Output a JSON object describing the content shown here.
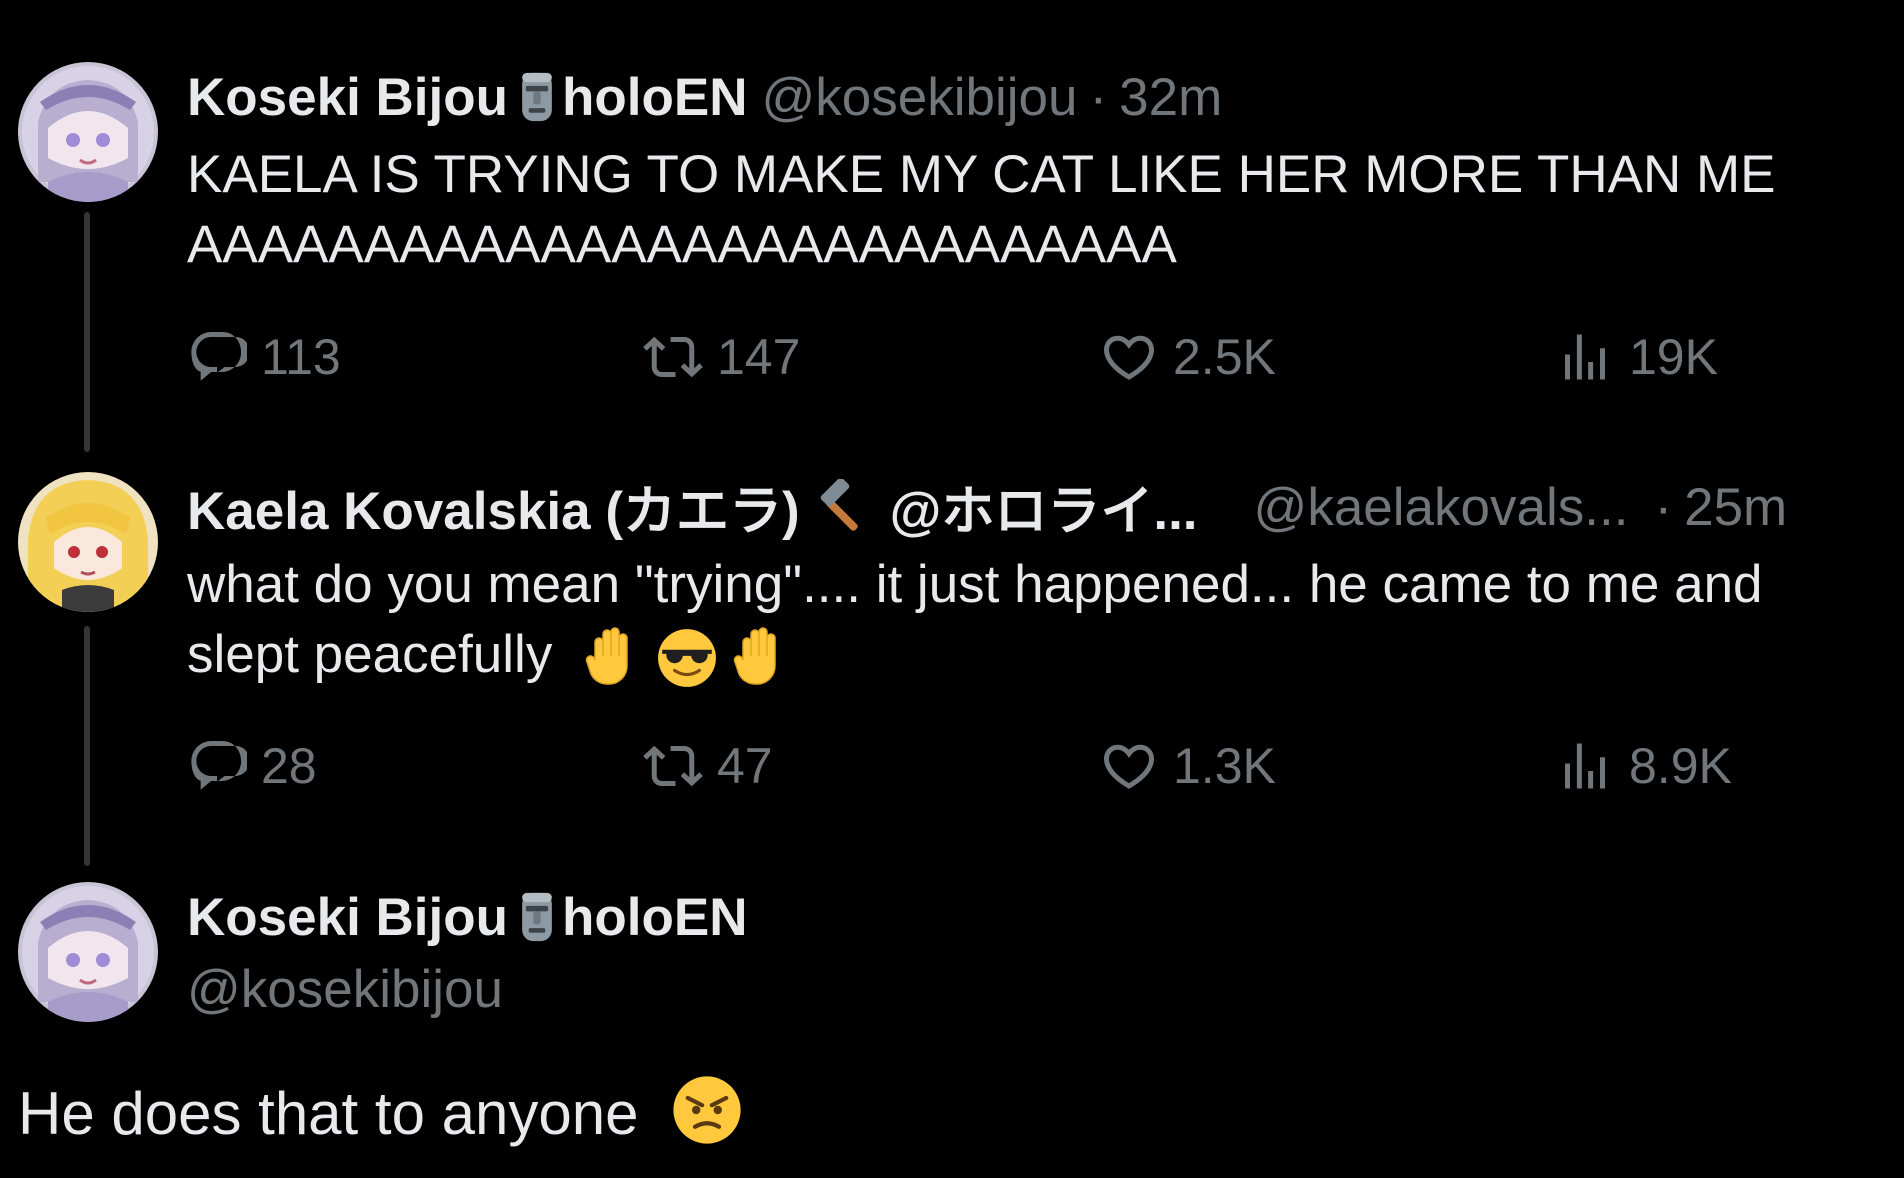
{
  "thread": [
    {
      "display_name": "Koseki Bijou",
      "name_suffix": "holoEN",
      "handle": "@kosekibijou",
      "separator": "·",
      "time": "32m",
      "text_lines": [
        "KAELA IS TRYING TO MAKE MY CAT LIKE HER MORE THAN ME",
        "AAAAAAAAAAAAAAAAAAAAAAAAAAAA"
      ],
      "replies": "113",
      "reposts": "147",
      "likes": "2.5K",
      "views": "19K"
    },
    {
      "display_name": "Kaela Kovalskia (カエラ)",
      "name_suffix": "@ホロライ...",
      "handle": "@kaelakovals...",
      "separator": "·",
      "time": "25m",
      "text_lines": [
        "what do you mean \"trying\".... it just happened... he came to me and",
        "slept peacefully"
      ],
      "replies": "28",
      "reposts": "47",
      "likes": "1.3K",
      "views": "8.9K"
    }
  ],
  "main_tweet": {
    "display_name": "Koseki Bijou",
    "name_suffix": "holoEN",
    "handle": "@kosekibijou",
    "text": "He does that to anyone"
  },
  "icons": {
    "reply": "reply-icon",
    "repost": "repost-icon",
    "like": "heart-icon",
    "views": "views-icon",
    "moai": "moai-emoji",
    "hammer": "hammer-emoji",
    "raised_hand": "raised-hand-emoji",
    "sunglasses": "sunglasses-emoji",
    "angry": "angry-face-emoji"
  },
  "colors": {
    "background": "#000000",
    "primary_text": "#e7e9ea",
    "secondary_text": "#71767b",
    "thread_line": "#333639"
  }
}
